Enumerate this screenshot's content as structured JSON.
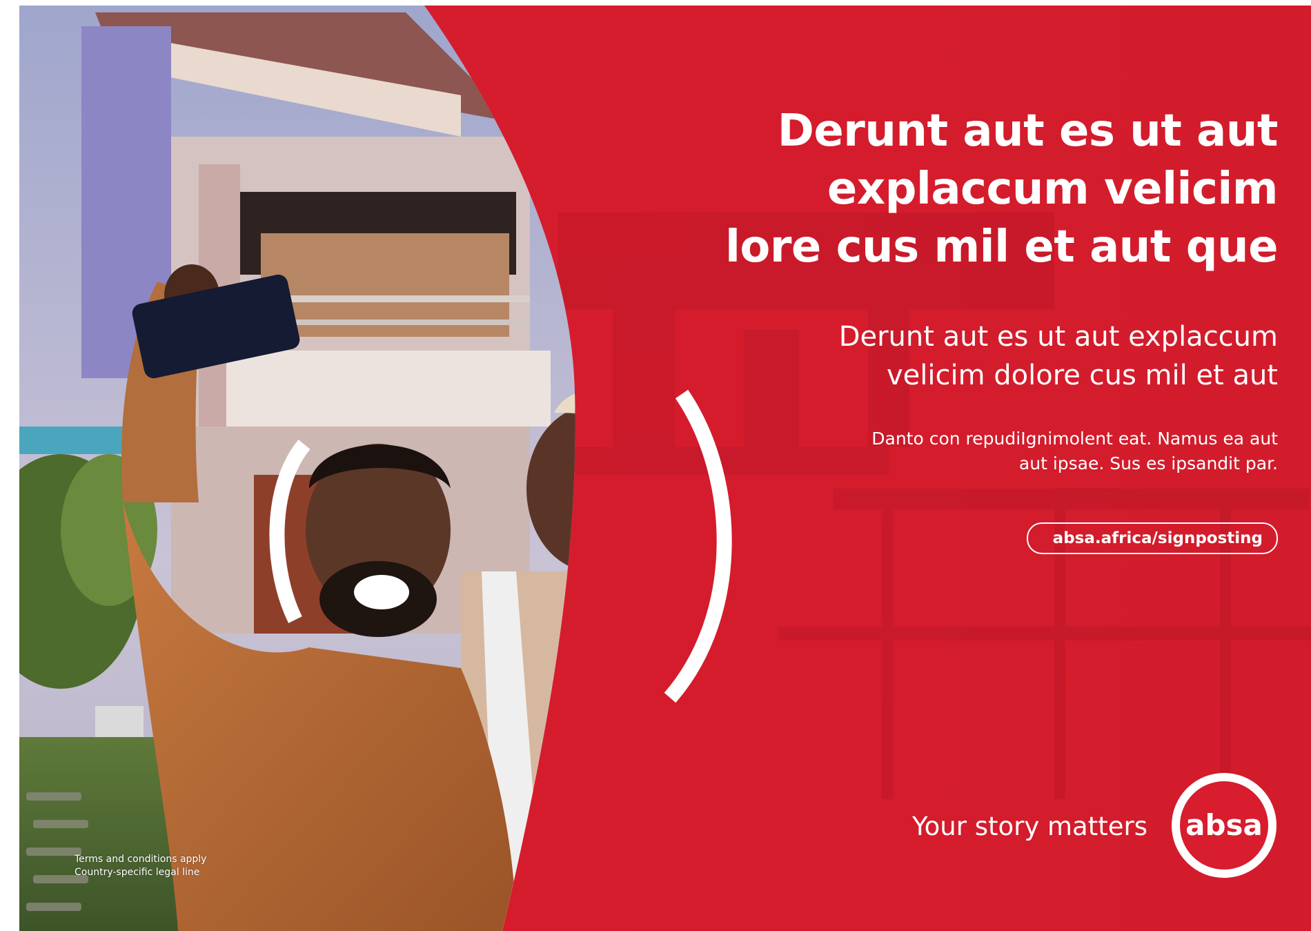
{
  "headline": {
    "lines": [
      "Derunt aut es ut aut",
      "explaccum velicim",
      "lore cus mil et aut que"
    ]
  },
  "subheadline": {
    "lines": [
      "Derunt aut es ut aut explaccum",
      "velicim dolore cus mil et aut"
    ]
  },
  "body": {
    "lines": [
      "Danto con repudiIgnimolent eat. Namus ea aut",
      "aut ipsae. Sus es ipsandit par."
    ]
  },
  "cta": {
    "url_label": "absa.africa/signposting"
  },
  "tagline": "Your story matters",
  "logo": {
    "text": "absa",
    "icon": "absa-logo-icon"
  },
  "legal": {
    "lines": [
      "Terms and conditions apply",
      "Country-specific legal line"
    ]
  },
  "photo": {
    "icon": "couple-selfie-photo"
  },
  "colors": {
    "brand_red": "#d71d2e",
    "brand_red_dark": "#c41a2a",
    "text": "#ffffff"
  }
}
